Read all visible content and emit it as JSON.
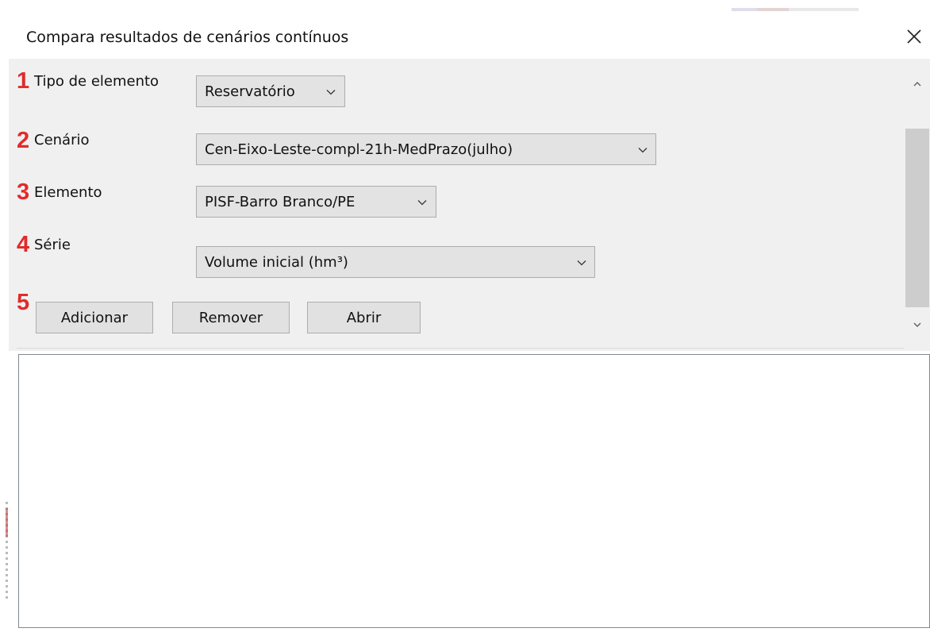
{
  "window": {
    "title": "Compara resultados de cenários contínuos",
    "close_icon": "close-icon"
  },
  "form": {
    "rows": [
      {
        "number": "1",
        "label": "Tipo de elemento",
        "value": "Reservatório"
      },
      {
        "number": "2",
        "label": "Cenário",
        "value": "Cen-Eixo-Leste-compl-21h-MedPrazo(julho)"
      },
      {
        "number": "3",
        "label": "Elemento",
        "value": "PISF-Barro Branco/PE"
      },
      {
        "number": "4",
        "label": "Série",
        "value": "Volume inicial (hm³)"
      }
    ],
    "buttons_row_number": "5",
    "buttons": {
      "add": "Adicionar",
      "remove": "Remover",
      "open": "Abrir"
    }
  },
  "colors": {
    "annotation_red": "#e12b2b",
    "panel_bg": "#f0f0f0",
    "control_bg": "#e3e3e3",
    "control_border": "#adadad"
  },
  "icons": {
    "dropdown": "chevron-down-icon",
    "scroll_up": "chevron-up-icon",
    "scroll_down": "chevron-down-icon"
  }
}
